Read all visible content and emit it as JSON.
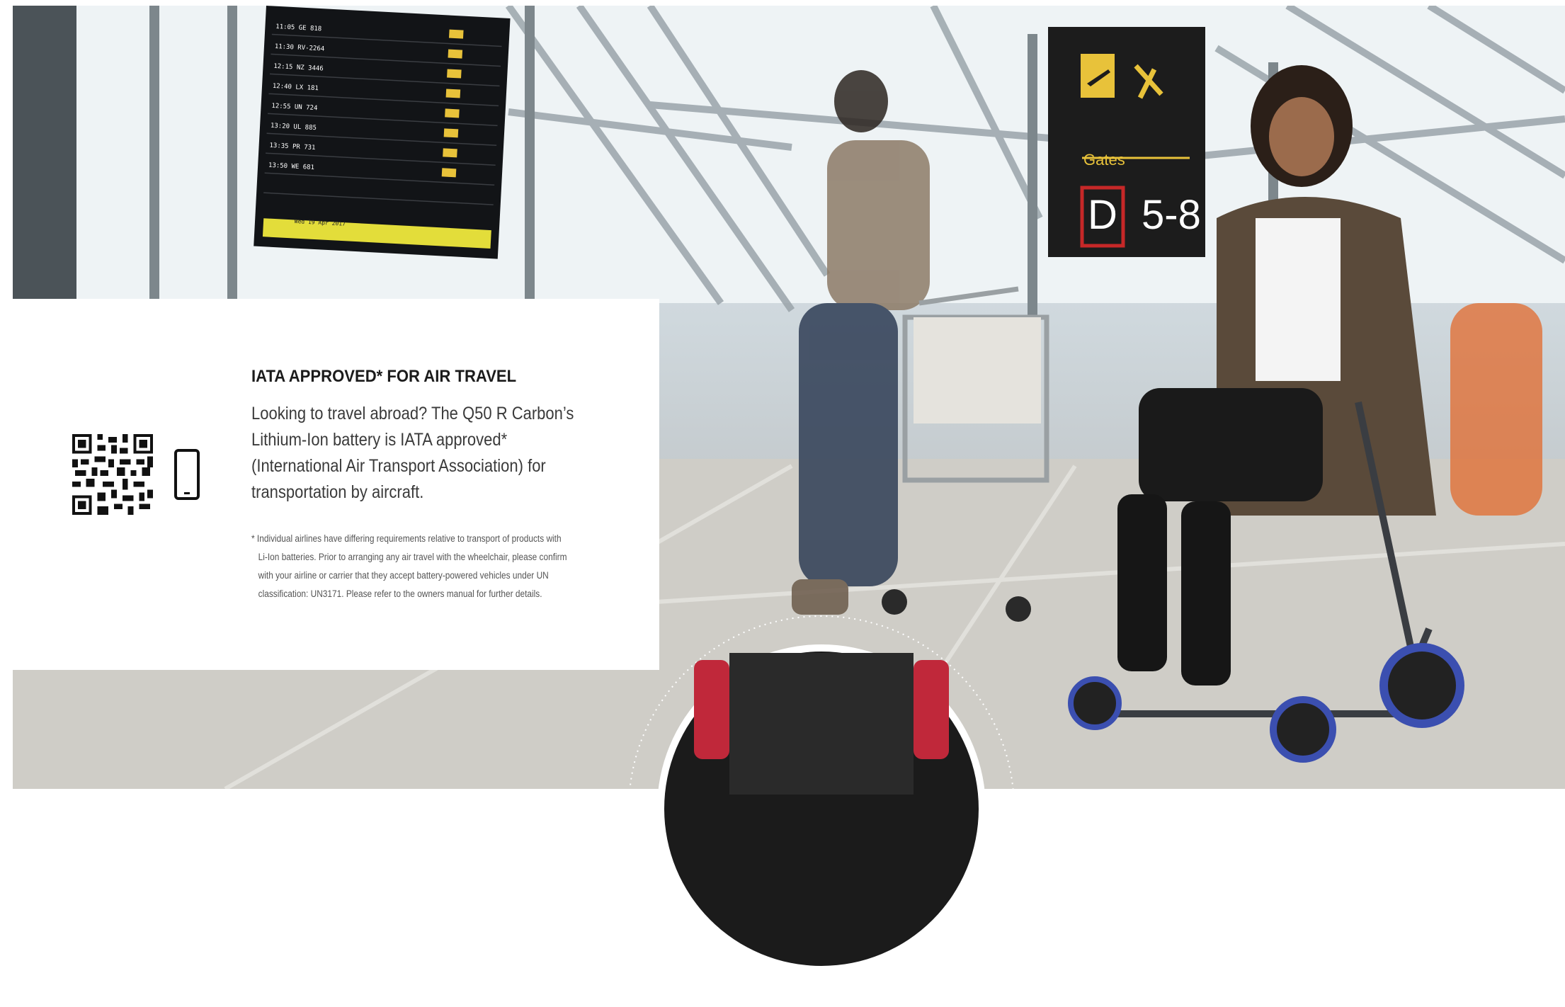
{
  "photo": {
    "flight_board_rows": [
      "11:05 GE 818",
      "11:30 RV-2264",
      "12:15 NZ 3446",
      "12:40 LX 181",
      "12:55 UN 724",
      "13:20 UL 885",
      "13:35 PR 731",
      "13:50 WE 681"
    ],
    "flight_board_footer": "Wed 19 Apr 2017",
    "gate_sign": {
      "label": "Gates",
      "letter": "D",
      "range": "5-8",
      "icons": [
        "airplane-departure-icon",
        "escalator-icon"
      ]
    }
  },
  "info_panel": {
    "heading": "IATA APPROVED* FOR AIR TRAVEL",
    "body": "Looking to travel abroad? The Q50 R Carbon’s Lithium-Ion battery is IATA approved* (International Air Transport Association) for transportation by aircraft.",
    "footnote_line1": "* Individual airlines have differing requirements relative to transport of products with",
    "footnote_line2": "Li-Ion batteries. Prior to arranging any air travel with the wheelchair, please confirm",
    "footnote_line3": "with your airline or carrier that they accept battery-powered vehicles under UN",
    "footnote_line4": "classification: UN3171. Please refer to the owners manual for further details.",
    "icons": [
      "qr-code-icon",
      "smartphone-icon"
    ]
  },
  "colors": {
    "sign_yellow": "#e8c23a",
    "sign_background": "#1c1c1c",
    "gate_letter_box": "#c62828",
    "text_dark": "#1b1b1b",
    "chair_accent_blue": "#3b4fb0",
    "chair_accent_red": "#c0283a"
  }
}
